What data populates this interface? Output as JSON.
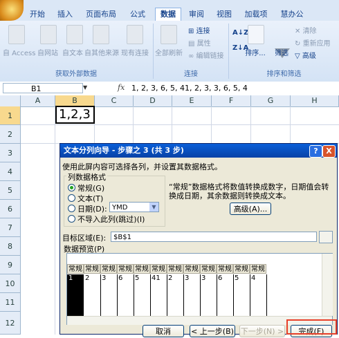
{
  "ribbon": {
    "tabs": [
      "开始",
      "插入",
      "页面布局",
      "公式",
      "数据",
      "审阅",
      "视图",
      "加载项",
      "慧办公"
    ],
    "active_tab": "数据",
    "groups": {
      "external_data": {
        "label": "获取外部数据",
        "buttons": [
          "自 Access",
          "自网站",
          "自文本",
          "自其他来源",
          "现有连接"
        ]
      },
      "connections": {
        "label": "连接",
        "refresh": "全部刷新",
        "items": [
          "连接",
          "属性",
          "编辑链接"
        ]
      },
      "sort_filter": {
        "label": "排序和筛选",
        "sort": "排序...",
        "filter": "筛选",
        "items": [
          "清除",
          "重新应用",
          "高级"
        ]
      }
    }
  },
  "formula_bar": {
    "name_box": "B1",
    "fx": "fx",
    "formula": "1, 2, 3, 6, 5, 41, 2, 3, 3, 6, 5, 4"
  },
  "sheet": {
    "columns": [
      "A",
      "B",
      "C",
      "D",
      "E",
      "F",
      "G",
      "H"
    ],
    "rows": [
      "1",
      "2",
      "3",
      "4",
      "5",
      "6",
      "7",
      "8",
      "9",
      "10",
      "11",
      "12"
    ],
    "b1_value": "1,2,3"
  },
  "dialog": {
    "title": "文本分列向导 - 步骤之 3 (共 3 步)",
    "help_btn": "?",
    "close_btn": "X",
    "instruction": "使用此屏内容可选择各列，并设置其数据格式。",
    "column_format_label": "列数据格式",
    "formats": [
      "常规(G)",
      "文本(T)",
      "日期(D):",
      "不导入此列(跳过)(I)"
    ],
    "selected_format": "常规(G)",
    "date_format": "YMD",
    "description": "“常规”数据格式将数值转换成数字，日期值会转换成日期，其余数据则转换成文本。",
    "advanced_btn": "高级(A)...",
    "target_label": "目标区域(E):",
    "target_value": "$B$1",
    "preview_label": "数据预览(P)",
    "preview_headers": [
      "常规",
      "常规",
      "常规",
      "常规",
      "常规",
      "常规",
      "常规",
      "常规",
      "常规",
      "常规",
      "常规",
      "常规"
    ],
    "preview_values": [
      "1",
      "2",
      "3",
      "6",
      "5",
      "41",
      "2",
      "3",
      "3",
      "6",
      "5",
      "4"
    ],
    "buttons": {
      "cancel": "取消",
      "back": "< 上一步(B)",
      "next": "下一步(N) >",
      "finish": "完成(F)"
    }
  },
  "colors": {
    "highlight": "#e8402a",
    "title_bar": "#0a5fd8"
  }
}
